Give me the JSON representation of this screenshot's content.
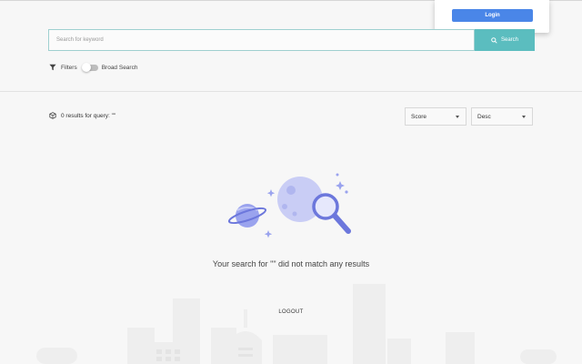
{
  "login": {
    "button_label": "Login"
  },
  "search": {
    "placeholder": "Search for keyword",
    "button_label": "Search"
  },
  "filters": {
    "label": "Filters",
    "broad_search_label": "Broad Search",
    "broad_search_on": false
  },
  "results": {
    "count_text": "0 results for query: \"\""
  },
  "sort": {
    "field_value": "Score",
    "order_value": "Desc"
  },
  "empty_state": {
    "message": "Your search for \"\" did not match any results"
  },
  "footer": {
    "logout_label": "LOGOUT"
  },
  "colors": {
    "accent": "#5bbdbf",
    "login": "#4a86e8",
    "illustration": "#7b86e0"
  }
}
